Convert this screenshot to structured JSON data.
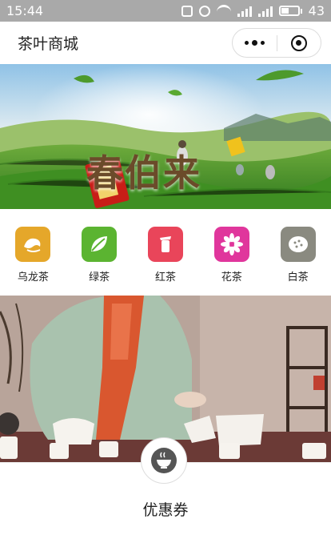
{
  "status_bar": {
    "time": "15:44",
    "battery_level": "43"
  },
  "nav": {
    "title": "茶叶商城"
  },
  "banner": {
    "headline": "春伯来"
  },
  "categories": [
    {
      "label": "乌龙茶",
      "color": "#e5a72a"
    },
    {
      "label": "绿茶",
      "color": "#5bb431"
    },
    {
      "label": "红茶",
      "color": "#e9455a"
    },
    {
      "label": "花茶",
      "color": "#e0369c"
    },
    {
      "label": "白茶",
      "color": "#8a8a80"
    }
  ],
  "coupon": {
    "label": "优惠券"
  }
}
